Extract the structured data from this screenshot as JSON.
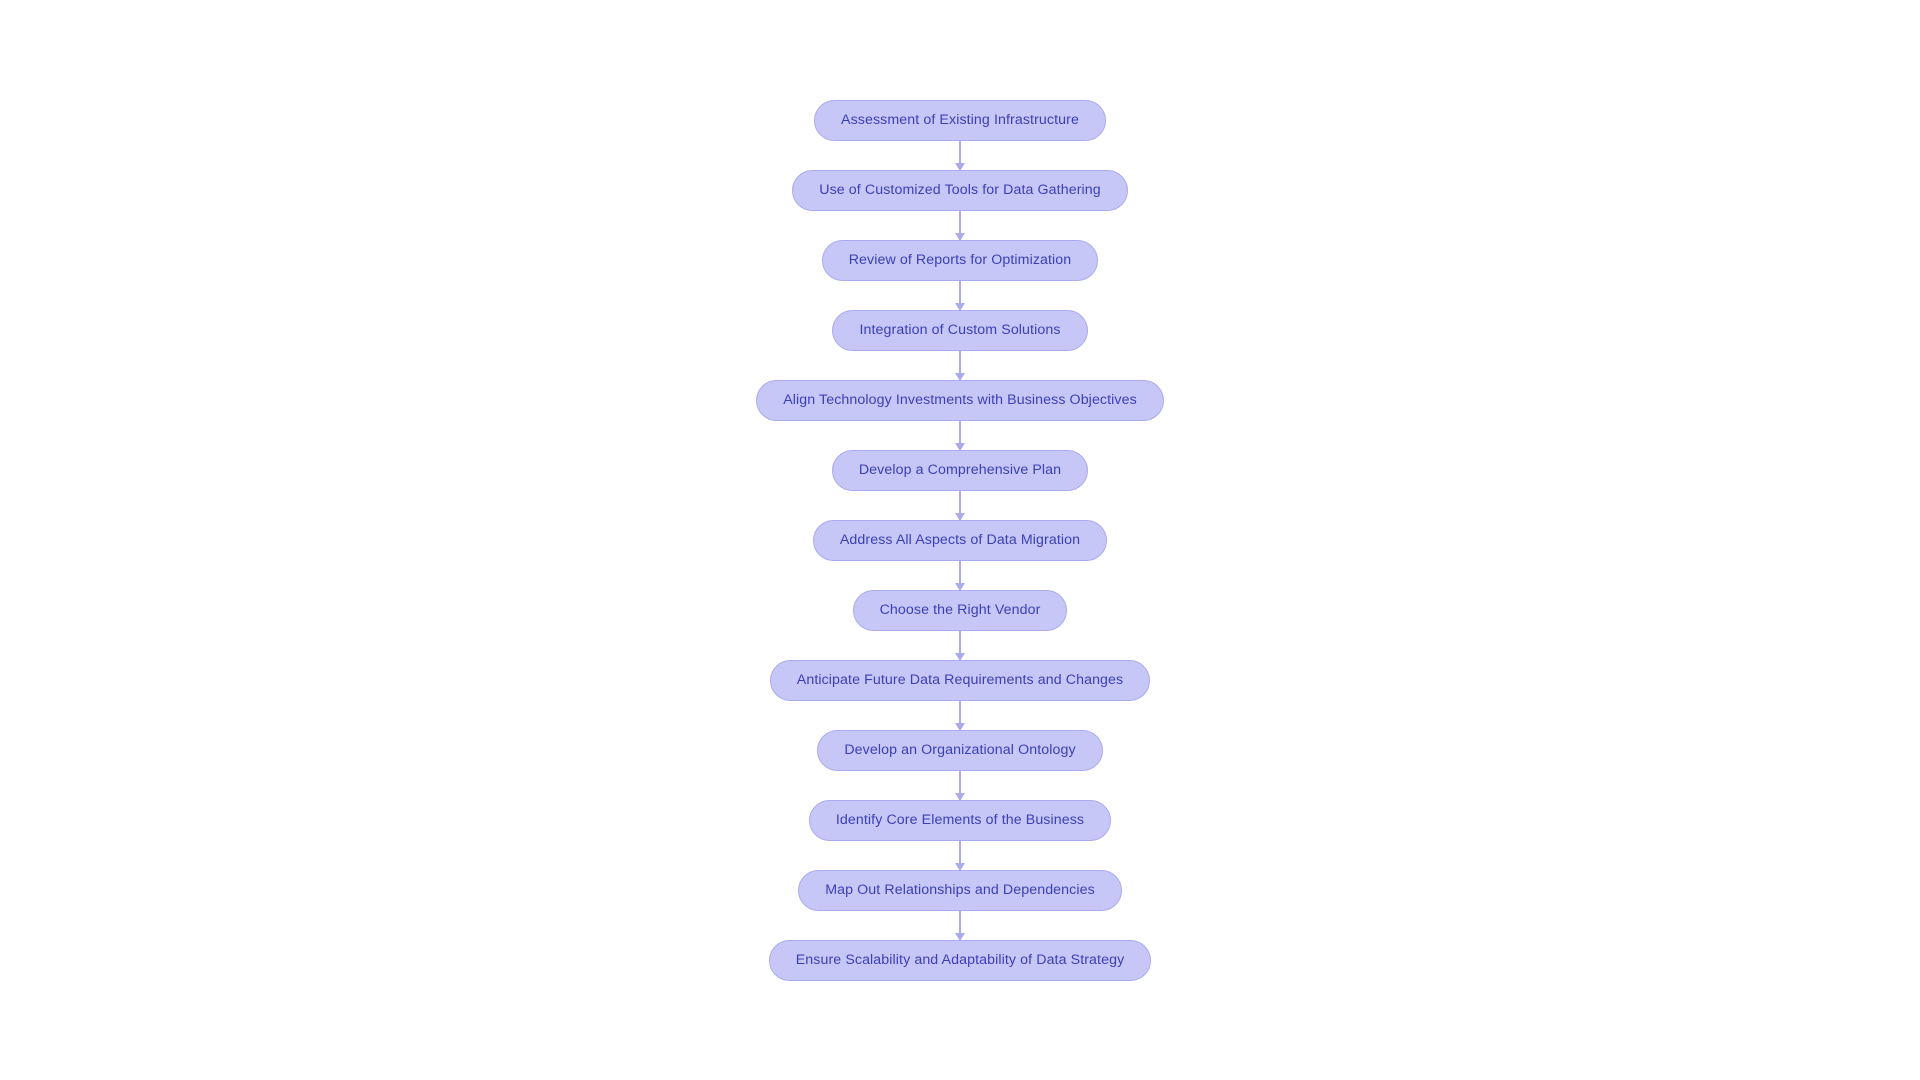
{
  "diagram": {
    "type": "flowchart",
    "orientation": "top-to-bottom",
    "background_color": "#ffffff",
    "node_fill_color": "#c6c7f7",
    "node_border_color": "#a9abec",
    "node_text_color": "#3b3fb5",
    "connector_color": "#a9abec",
    "nodes": [
      {
        "id": "n1",
        "label": "Assessment of Existing Infrastructure"
      },
      {
        "id": "n2",
        "label": "Use of Customized Tools for Data Gathering"
      },
      {
        "id": "n3",
        "label": "Review of Reports for Optimization"
      },
      {
        "id": "n4",
        "label": "Integration of Custom Solutions"
      },
      {
        "id": "n5",
        "label": "Align Technology Investments with Business Objectives"
      },
      {
        "id": "n6",
        "label": "Develop a Comprehensive Plan"
      },
      {
        "id": "n7",
        "label": "Address All Aspects of Data Migration"
      },
      {
        "id": "n8",
        "label": "Choose the Right Vendor"
      },
      {
        "id": "n9",
        "label": "Anticipate Future Data Requirements and Changes"
      },
      {
        "id": "n10",
        "label": "Develop an Organizational Ontology"
      },
      {
        "id": "n11",
        "label": "Identify Core Elements of the Business"
      },
      {
        "id": "n12",
        "label": "Map Out Relationships and Dependencies"
      },
      {
        "id": "n13",
        "label": "Ensure Scalability and Adaptability of Data Strategy"
      }
    ],
    "edges": [
      {
        "from": "n1",
        "to": "n2",
        "arrow": "down-arrow"
      },
      {
        "from": "n2",
        "to": "n3",
        "arrow": "down-arrow"
      },
      {
        "from": "n3",
        "to": "n4",
        "arrow": "down-arrow"
      },
      {
        "from": "n4",
        "to": "n5",
        "arrow": "down-arrow"
      },
      {
        "from": "n5",
        "to": "n6",
        "arrow": "down-arrow"
      },
      {
        "from": "n6",
        "to": "n7",
        "arrow": "down-arrow"
      },
      {
        "from": "n7",
        "to": "n8",
        "arrow": "down-arrow"
      },
      {
        "from": "n8",
        "to": "n9",
        "arrow": "down-arrow"
      },
      {
        "from": "n9",
        "to": "n10",
        "arrow": "down-arrow"
      },
      {
        "from": "n10",
        "to": "n11",
        "arrow": "down-arrow"
      },
      {
        "from": "n11",
        "to": "n12",
        "arrow": "down-arrow"
      },
      {
        "from": "n12",
        "to": "n13",
        "arrow": "down-arrow"
      }
    ]
  }
}
